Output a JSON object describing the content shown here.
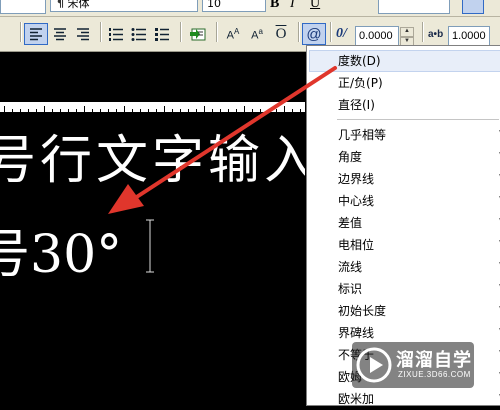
{
  "toolbar": {
    "font_name": "宋体",
    "font_size": "10",
    "bold_label": "B",
    "italic_label": "I",
    "underline_label": "U",
    "at_label": "@",
    "oblique_label": "0/",
    "oblique_value": "0.0000",
    "tracking_label": "a•b",
    "tracking_value": "1.0000"
  },
  "editor": {
    "line1": "号行文字输入",
    "line2": "号30°"
  },
  "menu": {
    "items": [
      {
        "label": "度数(D)",
        "shortcut": ""
      },
      {
        "label": "正/负(P)",
        "shortcut": ""
      },
      {
        "label": "直径(I)",
        "shortcut": ""
      },
      {
        "label": "几乎相等",
        "shortcut": "\\"
      },
      {
        "label": "角度",
        "shortcut": "\\"
      },
      {
        "label": "边界线",
        "shortcut": "\\"
      },
      {
        "label": "中心线",
        "shortcut": "\\"
      },
      {
        "label": "差值",
        "shortcut": "\\"
      },
      {
        "label": "电相位",
        "shortcut": "\\"
      },
      {
        "label": "流线",
        "shortcut": "\\"
      },
      {
        "label": "标识",
        "shortcut": "\\"
      },
      {
        "label": "初始长度",
        "shortcut": "\\"
      },
      {
        "label": "界碑线",
        "shortcut": "\\"
      },
      {
        "label": "不等于",
        "shortcut": "\\"
      },
      {
        "label": "欧姆",
        "shortcut": "\\"
      },
      {
        "label": "欧米加",
        "shortcut": "\\"
      }
    ]
  },
  "watermark": {
    "title": "溜溜自学",
    "url": "ZIXUE.3D66.COM"
  },
  "colors": {
    "arrow": "#e0362c",
    "highlight": "#e8eef9",
    "toolbar_bg": "#ece9d8"
  }
}
